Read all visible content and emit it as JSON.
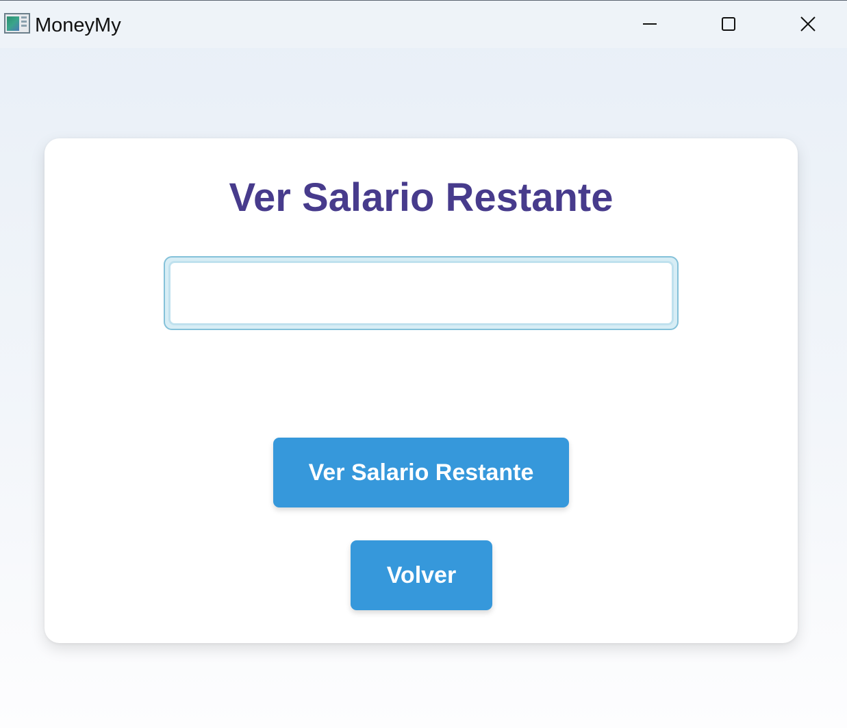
{
  "window": {
    "title": "MoneyMy",
    "icon": "app-icon",
    "controls": {
      "minimize_icon": "minimize-icon",
      "maximize_icon": "maximize-icon",
      "close_icon": "close-icon"
    }
  },
  "main": {
    "heading": "Ver Salario Restante",
    "input": {
      "value": "",
      "placeholder": ""
    },
    "primary_button_label": "Ver Salario Restante",
    "back_button_label": "Volver"
  },
  "colors": {
    "heading": "#473b8c",
    "button": "#3698db",
    "button_text": "#ffffff",
    "input_border": "#84c1d9"
  }
}
